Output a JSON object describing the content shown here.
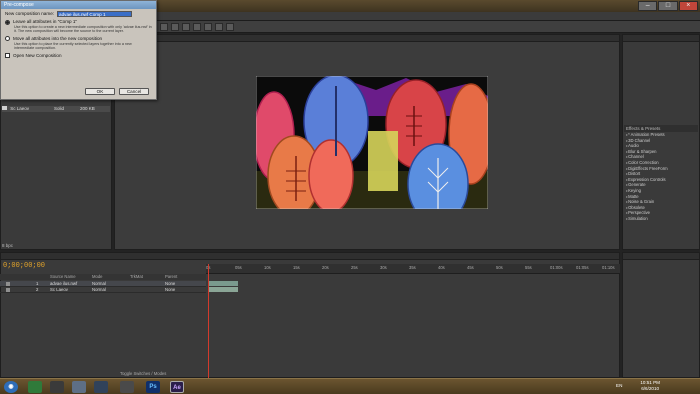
{
  "dialog": {
    "title": "Pre-compose",
    "name_label": "New composition name:",
    "name_value": "advae ilus.nwf Comp 1",
    "option1_label": "Leave all attributes in \"Comp 1\"",
    "option1_desc": "Use this option to create a new intermediate composition with only 'advae ilus.nwf' in it. The new composition will become the source to the current layer.",
    "option2_label": "Move all attributes into the new composition",
    "option2_desc": "Use this option to place the currently selected layers together into a new intermediate composition.",
    "open_label": "Open New Composition",
    "ok_label": "OK",
    "cancel_label": "Cancel"
  },
  "project": {
    "rows": [
      {
        "name": "Sc Laeov",
        "type": "Solid",
        "size": "200 KB"
      }
    ],
    "footer": "8 bpc"
  },
  "effects": {
    "header": "Effects & Presets",
    "items": [
      "* Animation Presets",
      "3D Channel",
      "Audio",
      "Blur & Sharpen",
      "Channel",
      "Color Correction",
      "DigiEffects FreeForm",
      "Distort",
      "Expression Controls",
      "Generate",
      "Keying",
      "Matte",
      "Noise & Grain",
      "Obsolete",
      "Perspective",
      "Simulation"
    ]
  },
  "timeline": {
    "timecode": "0;00;00;00",
    "columns": {
      "name": "Source Name",
      "mode": "Mode",
      "trkmat": "TrkMat",
      "parent": "Parent"
    },
    "ticks": [
      "0s",
      "05s",
      "10s",
      "15s",
      "20s",
      "25s",
      "30s",
      "35s",
      "40s",
      "45s",
      "50s",
      "55s",
      "01:00s",
      "01:05s",
      "01:10s"
    ],
    "layers": [
      {
        "num": "1",
        "name": "advae ilus.nwf",
        "mode": "Normal",
        "parent": "None"
      },
      {
        "num": "2",
        "name": "Sc Laeov",
        "mode": "Normal",
        "parent": "None"
      }
    ],
    "footer_label": "Toggle Switches / Modes"
  },
  "taskbar": {
    "lang": "EN",
    "time": "10:51 PM",
    "date": "6/6/2010",
    "apps": [
      "Ps",
      "Ae"
    ]
  }
}
